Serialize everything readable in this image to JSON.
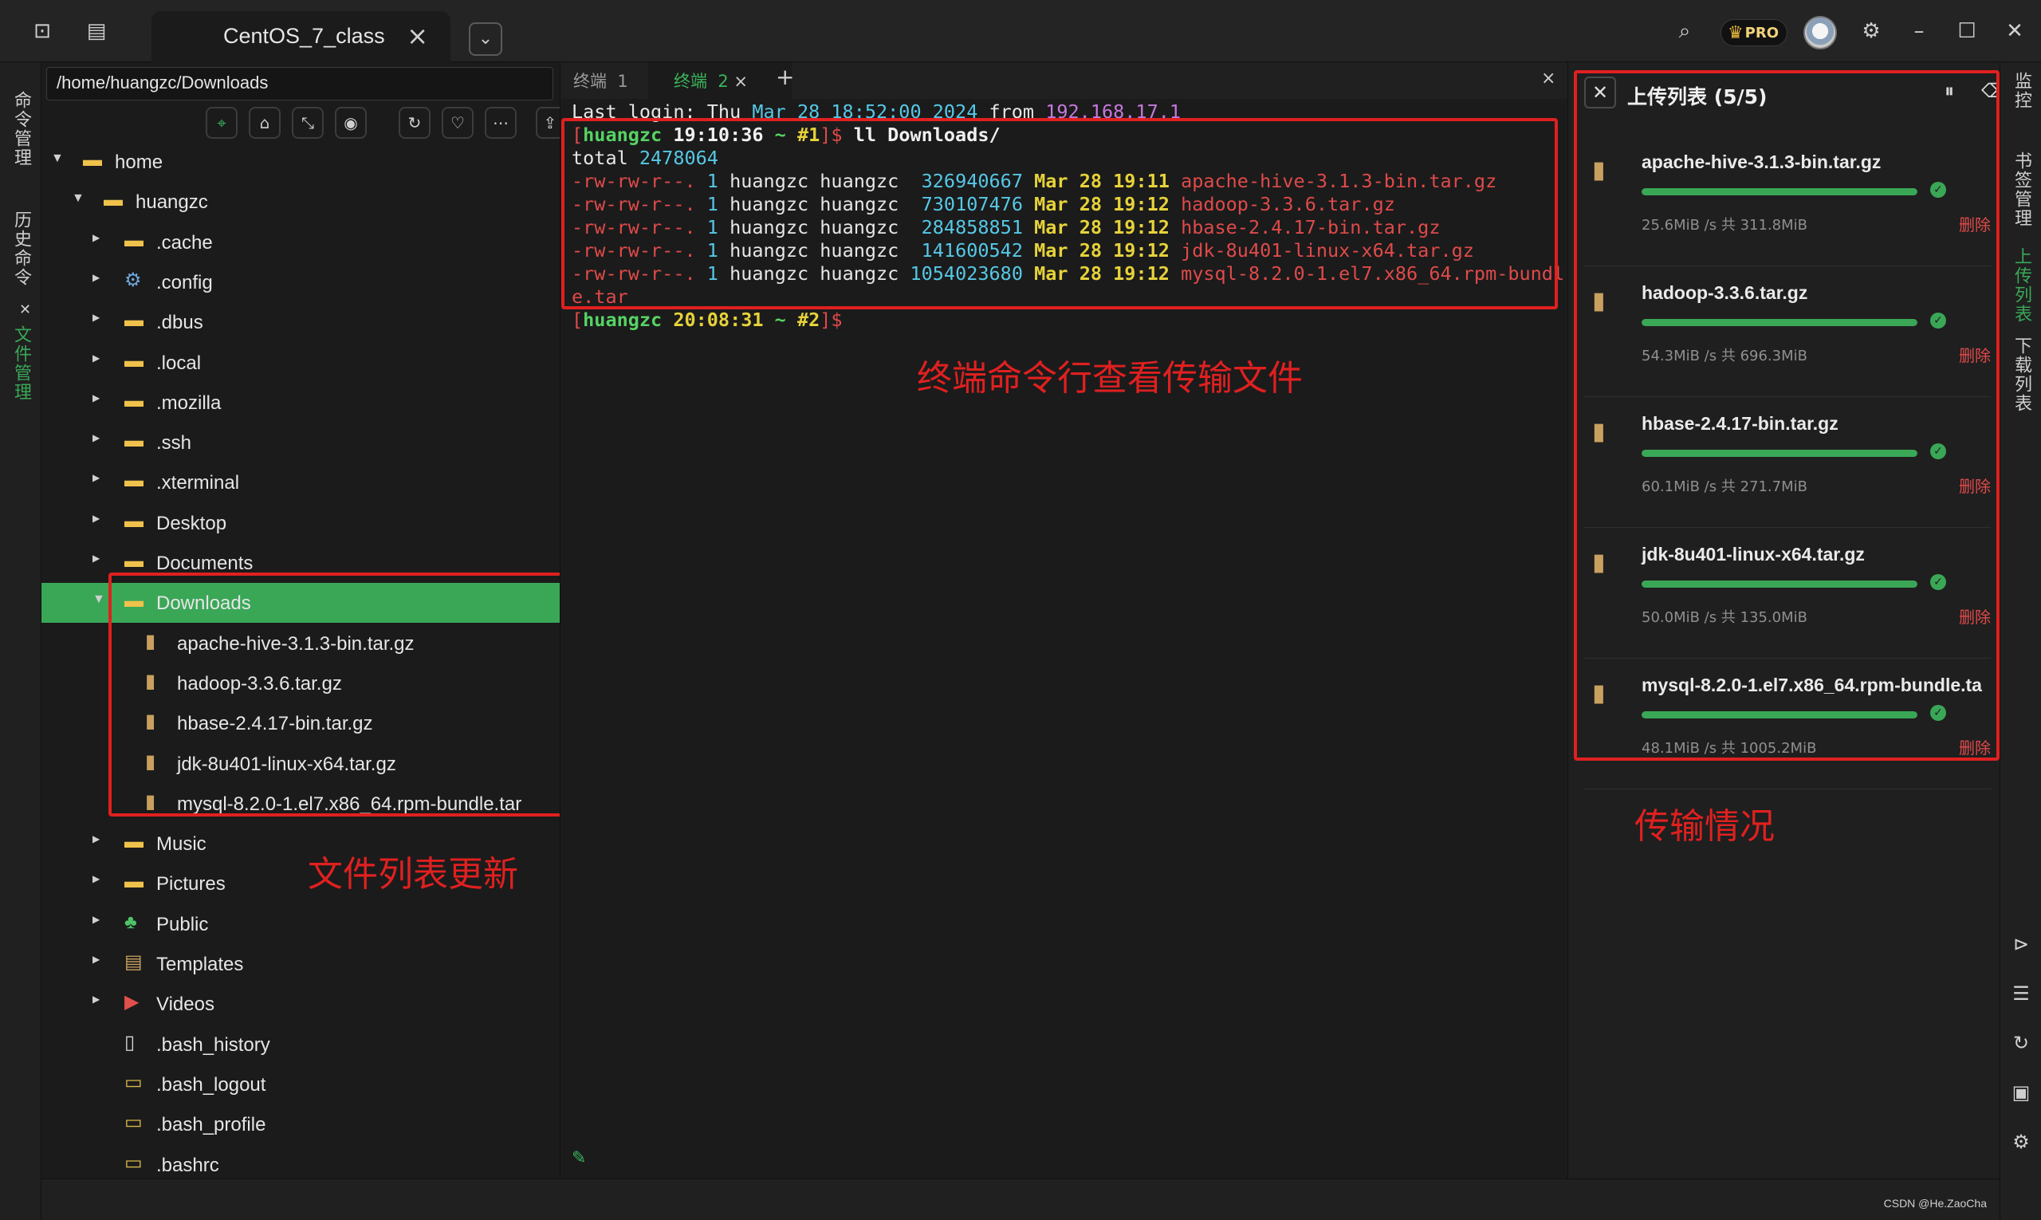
{
  "window": {
    "tab_title": "CentOS_7_class",
    "pro_badge": "PRO"
  },
  "left_sidebar": {
    "items": [
      "命令管理",
      "历史命令",
      "文件管理"
    ]
  },
  "file_panel": {
    "path": "/home/huangzc/Downloads",
    "tree": [
      {
        "name": "home",
        "type": "folder",
        "depth": 0,
        "expanded": true
      },
      {
        "name": "huangzc",
        "type": "folder",
        "depth": 1,
        "expanded": true
      },
      {
        "name": ".cache",
        "type": "folder",
        "depth": 2
      },
      {
        "name": ".config",
        "type": "folder-gear",
        "depth": 2
      },
      {
        "name": ".dbus",
        "type": "folder",
        "depth": 2
      },
      {
        "name": ".local",
        "type": "folder",
        "depth": 2
      },
      {
        "name": ".mozilla",
        "type": "folder",
        "depth": 2
      },
      {
        "name": ".ssh",
        "type": "folder",
        "depth": 2
      },
      {
        "name": ".xterminal",
        "type": "folder",
        "depth": 2
      },
      {
        "name": "Desktop",
        "type": "folder",
        "depth": 2
      },
      {
        "name": "Documents",
        "type": "folder",
        "depth": 2
      },
      {
        "name": "Downloads",
        "type": "folder",
        "depth": 2,
        "expanded": true,
        "selected": true
      },
      {
        "name": "apache-hive-3.1.3-bin.tar.gz",
        "type": "archive",
        "depth": 3
      },
      {
        "name": "hadoop-3.3.6.tar.gz",
        "type": "archive",
        "depth": 3
      },
      {
        "name": "hbase-2.4.17-bin.tar.gz",
        "type": "archive",
        "depth": 3
      },
      {
        "name": "jdk-8u401-linux-x64.tar.gz",
        "type": "archive",
        "depth": 3
      },
      {
        "name": "mysql-8.2.0-1.el7.x86_64.rpm-bundle.tar",
        "type": "archive",
        "depth": 3
      },
      {
        "name": "Music",
        "type": "folder",
        "depth": 2
      },
      {
        "name": "Pictures",
        "type": "folder",
        "depth": 2
      },
      {
        "name": "Public",
        "type": "folder-public",
        "depth": 2
      },
      {
        "name": "Templates",
        "type": "folder-templates",
        "depth": 2
      },
      {
        "name": "Videos",
        "type": "folder-videos",
        "depth": 2
      },
      {
        "name": ".bash_history",
        "type": "file",
        "depth": 2
      },
      {
        "name": ".bash_logout",
        "type": "script",
        "depth": 2
      },
      {
        "name": ".bash_profile",
        "type": "script",
        "depth": 2
      },
      {
        "name": ".bashrc",
        "type": "script",
        "depth": 2
      }
    ],
    "annotation": "文件列表更新"
  },
  "terminal": {
    "tabs": [
      {
        "label": "终端",
        "num": "1",
        "active": false
      },
      {
        "label": "终端",
        "num": "2",
        "active": true
      }
    ],
    "last_login": {
      "prefix": "Last login: Thu ",
      "date": "Mar 28 18:52:00 2024",
      "from": " from ",
      "ip": "192.168.17.1"
    },
    "prompt1": {
      "user": "huangzc",
      "time": "19:10:36",
      "path": "~",
      "num": "#1",
      "cmd": " ll Downloads/"
    },
    "total": {
      "label": "total ",
      "value": "2478064"
    },
    "files": [
      {
        "perm": "-rw-rw-r--.",
        "links": "1",
        "owner": "huangzc",
        "group": "huangzc",
        "size": " 326940667",
        "date": "Mar 28 19:11",
        "name": "apache-hive-3.1.3-bin.tar.gz"
      },
      {
        "perm": "-rw-rw-r--.",
        "links": "1",
        "owner": "huangzc",
        "group": "huangzc",
        "size": " 730107476",
        "date": "Mar 28 19:12",
        "name": "hadoop-3.3.6.tar.gz"
      },
      {
        "perm": "-rw-rw-r--.",
        "links": "1",
        "owner": "huangzc",
        "group": "huangzc",
        "size": " 284858851",
        "date": "Mar 28 19:12",
        "name": "hbase-2.4.17-bin.tar.gz"
      },
      {
        "perm": "-rw-rw-r--.",
        "links": "1",
        "owner": "huangzc",
        "group": "huangzc",
        "size": " 141600542",
        "date": "Mar 28 19:12",
        "name": "jdk-8u401-linux-x64.tar.gz"
      },
      {
        "perm": "-rw-rw-r--.",
        "links": "1",
        "owner": "huangzc",
        "group": "huangzc",
        "size": "1054023680",
        "date": "Mar 28 19:12",
        "name": "mysql-8.2.0-1.el7.x86_64.rpm-bundl",
        "name_wrap": "e.tar"
      }
    ],
    "prompt2": {
      "user": "huangzc",
      "time": "20:08:31",
      "path": "~",
      "num": "#2"
    },
    "annotation": "终端命令行查看传输文件"
  },
  "upload_panel": {
    "title": "上传列表 (5/5)",
    "delete_label": "删除",
    "items": [
      {
        "name": "apache-hive-3.1.3-bin.tar.gz",
        "speed": "25.6MiB /s",
        "total": "共 311.8MiB",
        "progress": 1.0
      },
      {
        "name": "hadoop-3.3.6.tar.gz",
        "speed": "54.3MiB /s",
        "total": "共 696.3MiB",
        "progress": 1.0
      },
      {
        "name": "hbase-2.4.17-bin.tar.gz",
        "speed": "60.1MiB /s",
        "total": "共 271.7MiB",
        "progress": 1.0
      },
      {
        "name": "jdk-8u401-linux-x64.tar.gz",
        "speed": "50.0MiB /s",
        "total": "共 135.0MiB",
        "progress": 1.0
      },
      {
        "name": "mysql-8.2.0-1.el7.x86_64.rpm-bundle.ta",
        "speed": "48.1MiB /s",
        "total": "共 1005.2MiB",
        "progress": 1.0
      }
    ],
    "annotation": "传输情况"
  },
  "right_sidebar": {
    "items": [
      "监控",
      "书签管理",
      "上传列表",
      "下载列表"
    ]
  },
  "status": {
    "watermark": "CSDN @He.ZaoCha"
  },
  "colors": {
    "accent": "#3aa757",
    "annotation": "#e02020",
    "folder": "#f0c24b"
  }
}
